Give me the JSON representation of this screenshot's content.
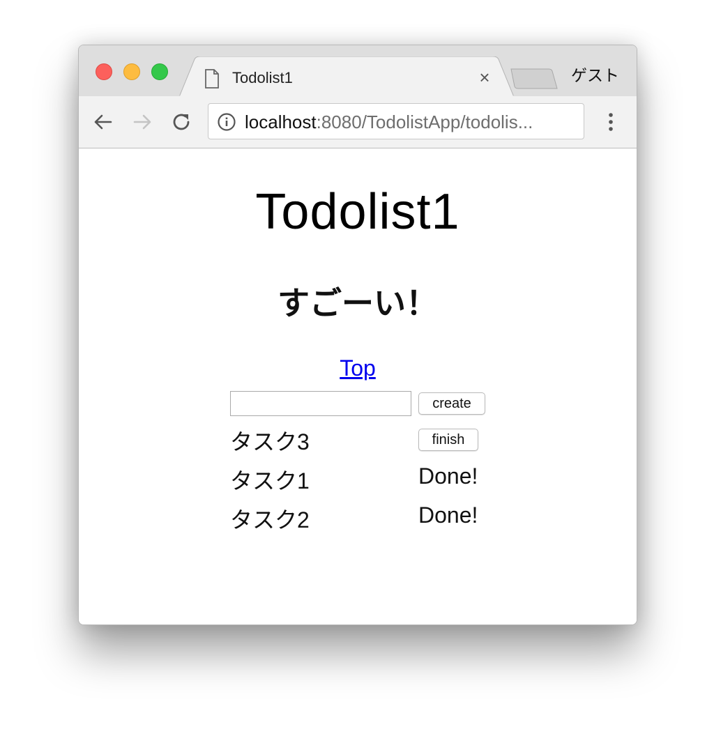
{
  "browser": {
    "tab_title": "Todolist1",
    "profile_label": "ゲスト",
    "url_host": "localhost",
    "url_path": ":8080/TodolistApp/todolis..."
  },
  "icons": {
    "tab_page": "document-icon",
    "tab_close": "close-icon",
    "back": "arrow-left-icon",
    "forward": "arrow-right-icon",
    "reload": "reload-icon",
    "site_info": "info-icon",
    "menu": "more-vertical-icon"
  },
  "colors": {
    "close_light": "#fc605c",
    "minimize_light": "#fdbc40",
    "maximize_light": "#34c84a",
    "link": "#0000ee"
  },
  "page": {
    "title": "Todolist1",
    "subtitle": "すごーい！",
    "top_link": "Top",
    "input_value": "",
    "create_label": "create",
    "tasks": [
      {
        "name": "タスク3",
        "action_label": "finish"
      },
      {
        "name": "タスク1",
        "status": "Done!"
      },
      {
        "name": "タスク2",
        "status": "Done!"
      }
    ]
  }
}
